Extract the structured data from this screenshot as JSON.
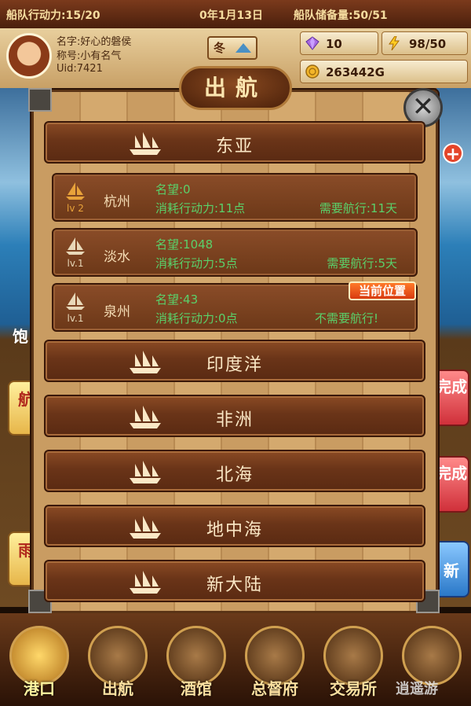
{
  "topbar": {
    "fleet_action": "船队行动力:15/20",
    "date": "0年1月13日",
    "fleet_reserve": "船队储备量:50/51"
  },
  "player": {
    "name": "名字:好心的磐侯",
    "title": "称号:小有名气",
    "uid": "Uid:7421"
  },
  "season": {
    "label": "冬"
  },
  "stats": {
    "diamonds": "10",
    "energy": "98/50",
    "gold": "263442G"
  },
  "dialog": {
    "title": "出航",
    "close_glyph": "✕",
    "regions": [
      {
        "name": "东亚"
      },
      {
        "name": "印度洋"
      },
      {
        "name": "非洲"
      },
      {
        "name": "北海"
      },
      {
        "name": "地中海"
      },
      {
        "name": "新大陆"
      }
    ],
    "cities": [
      {
        "level": "lv 2",
        "name": "杭州",
        "fame": "名望:0",
        "cost": "消耗行动力:11点",
        "sail": "需要航行:11天"
      },
      {
        "level": "lv.1",
        "name": "淡水",
        "fame": "名望:1048",
        "cost": "消耗行动力:5点",
        "sail": "需要航行:5天"
      },
      {
        "level": "lv.1",
        "name": "泉州",
        "fame": "名望:43",
        "cost": "消耗行动力:0点",
        "sail": "不需要航行!"
      }
    ],
    "current_badge": "当前位置"
  },
  "side": {
    "left_top": "航",
    "left_bottom": "雨",
    "left_partial": "饱",
    "done1": "完成",
    "done2": "完成",
    "new": "新",
    "plus": "+"
  },
  "nav": [
    {
      "label": "港口",
      "icon": "helm-icon"
    },
    {
      "label": "出航",
      "icon": "captain-icon"
    },
    {
      "label": "酒馆",
      "icon": "tavern-icon"
    },
    {
      "label": "总督府",
      "icon": "governor-icon"
    },
    {
      "label": "交易所",
      "icon": "shop-icon"
    },
    {
      "label": "",
      "icon": "gear-icon"
    }
  ],
  "watermark": "逍遥游",
  "colors": {
    "accent_text": "#5ad06a",
    "region_bar": "#6a3418",
    "badge": "#e4502a"
  }
}
